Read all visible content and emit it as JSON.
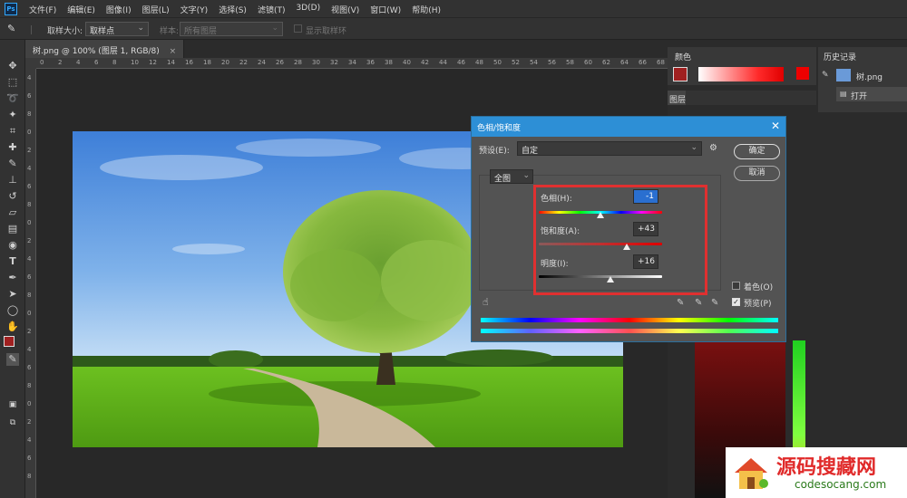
{
  "menubar": {
    "logo": "Ps",
    "items": [
      "文件(F)",
      "编辑(E)",
      "图像(I)",
      "图层(L)",
      "文字(Y)",
      "选择(S)",
      "滤镜(T)",
      "3D(D)",
      "视图(V)",
      "窗口(W)",
      "帮助(H)"
    ]
  },
  "options": {
    "sample_size_label": "取样大小:",
    "sample_size_value": "取样点",
    "sample_label": "样本:",
    "sample_value": "所有图层",
    "show_ring_label": "显示取样环"
  },
  "document": {
    "tab_title": "树.png @ 100% (图层 1, RGB/8)",
    "tab_close": "×",
    "ruler_h": [
      "0",
      "2",
      "4",
      "6",
      "8",
      "10",
      "12",
      "14",
      "16",
      "18",
      "20",
      "22",
      "24",
      "26",
      "28",
      "30",
      "32",
      "34",
      "36",
      "38",
      "40",
      "42",
      "44",
      "46",
      "48",
      "50",
      "52",
      "54",
      "56",
      "58",
      "60",
      "62",
      "64",
      "66",
      "68",
      "70"
    ],
    "ruler_v": [
      "4",
      "6",
      "8",
      "0",
      "2",
      "4",
      "6",
      "8",
      "0",
      "2",
      "4",
      "6",
      "8",
      "0",
      "2",
      "4",
      "6",
      "8",
      "0",
      "2",
      "4",
      "6",
      "8"
    ]
  },
  "panels": {
    "color_tab": "颜色",
    "history_tab": "历史记录",
    "history_file": "树.png",
    "history_open": "打开",
    "layers_tab": "图层"
  },
  "dialog": {
    "title": "色相/饱和度",
    "preset_label": "预设(E):",
    "preset_value": "自定",
    "ok": "确定",
    "cancel": "取消",
    "channel": "全图",
    "hue_label": "色相(H):",
    "hue_value": "-1",
    "saturation_label": "饱和度(A):",
    "saturation_value": "+43",
    "lightness_label": "明度(I):",
    "lightness_value": "+16",
    "colorize_label": "着色(O)",
    "preview_label": "预览(P)",
    "hue_pos": 0.498,
    "saturation_pos": 0.715,
    "lightness_pos": 0.58
  },
  "watermark": {
    "title": "源码搜藏网",
    "url": "codesocang.com"
  },
  "colors": {
    "accent": "#2d8fd6",
    "highlight_box": "#e03030",
    "foreground": "#a02020"
  }
}
